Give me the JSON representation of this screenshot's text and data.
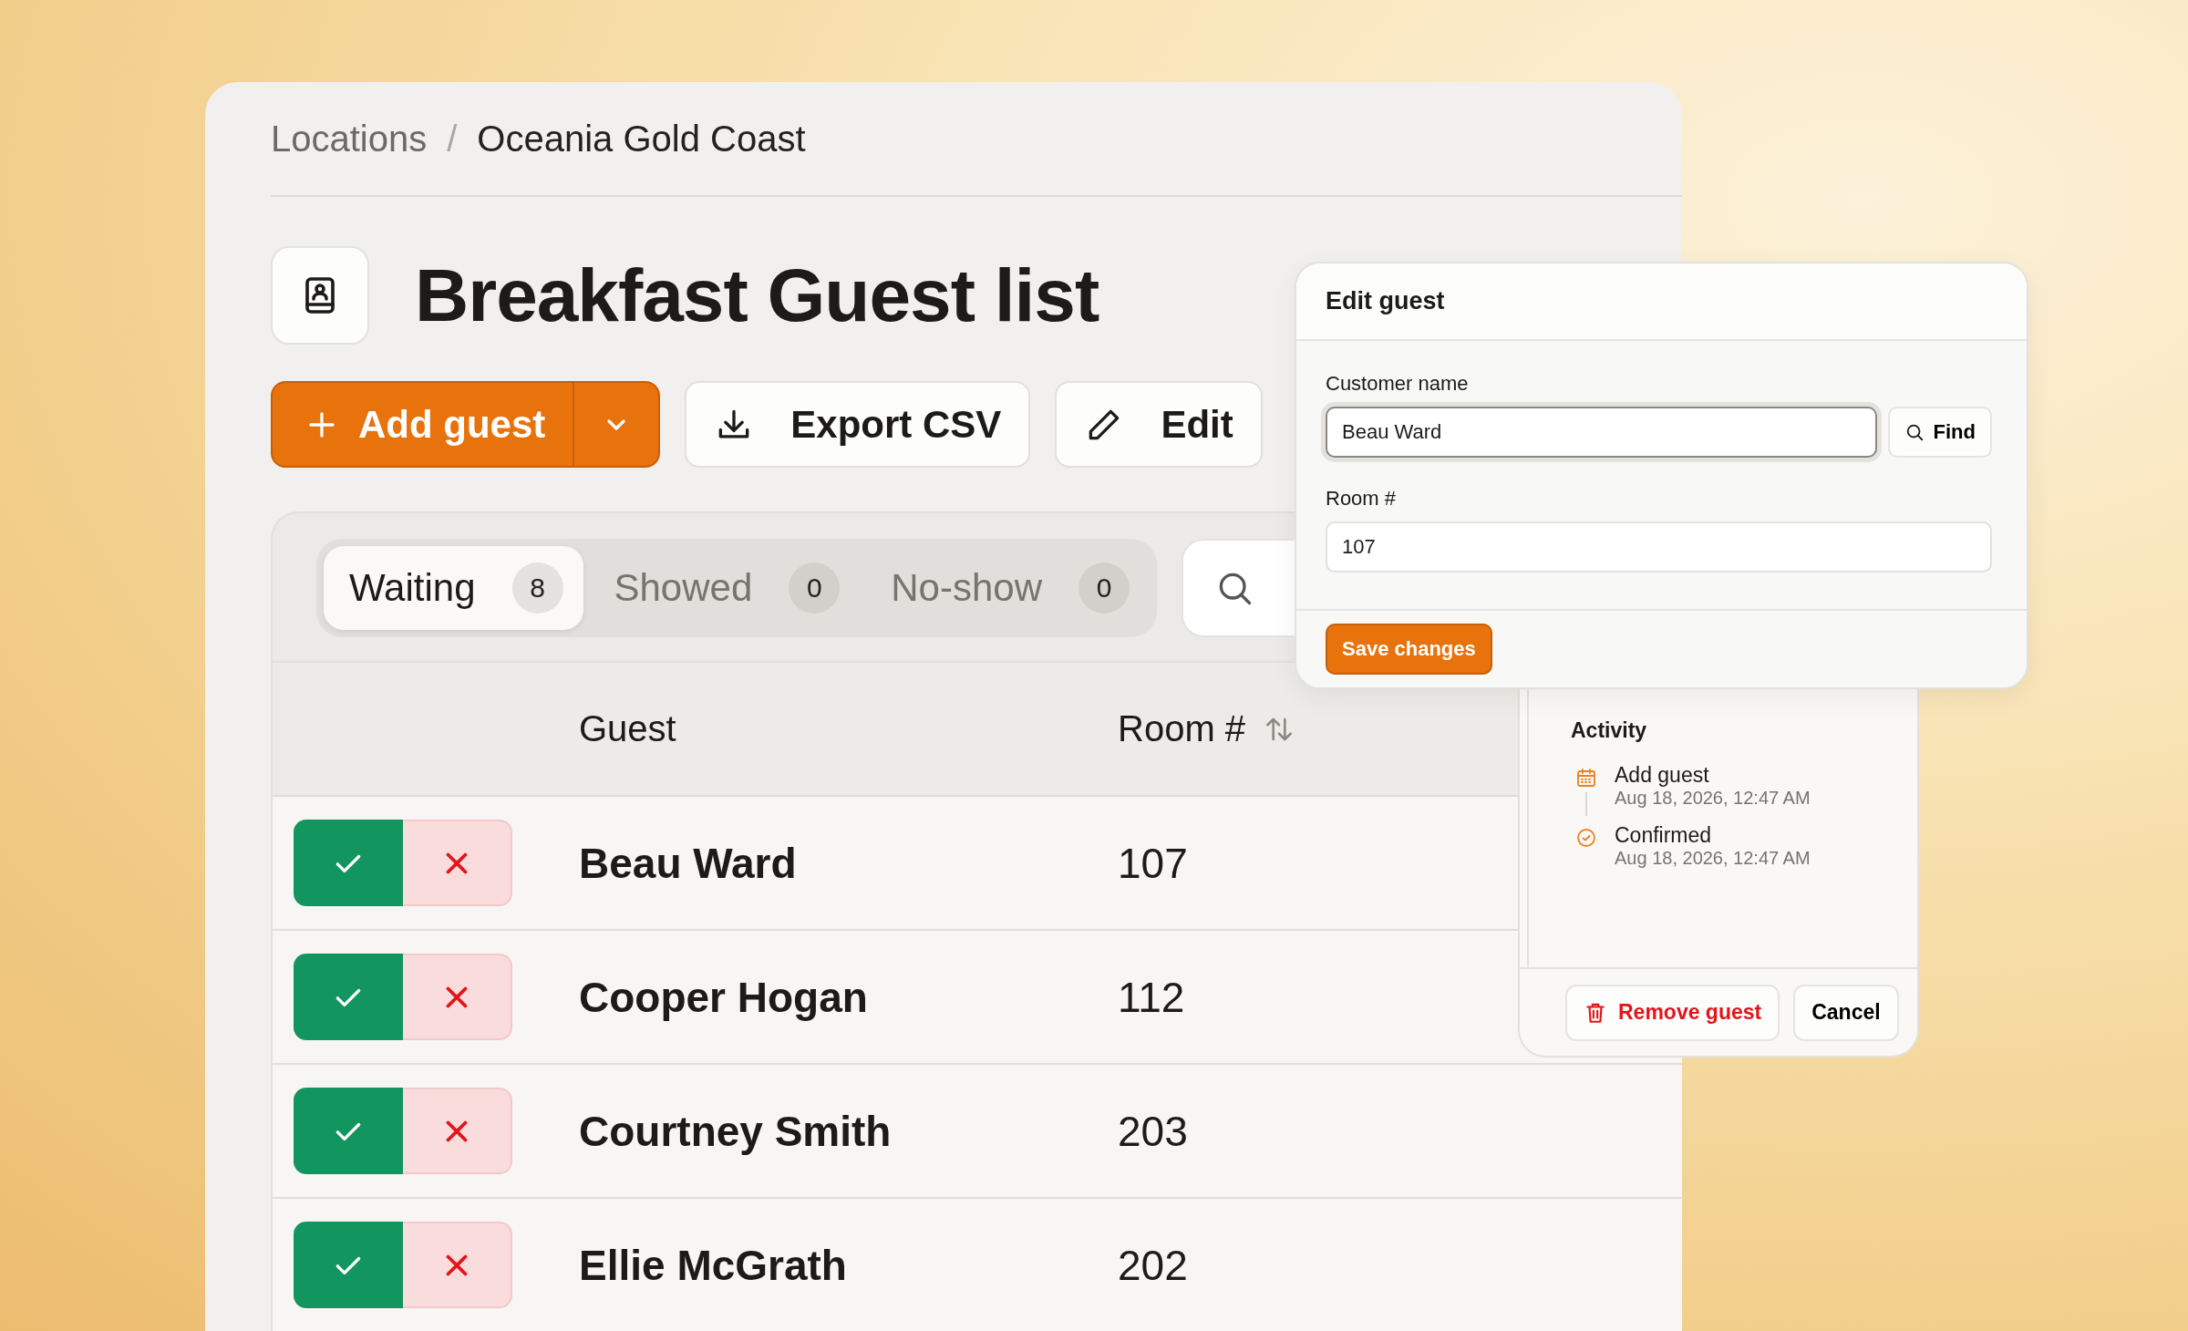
{
  "breadcrumb": [
    {
      "label": "Locations",
      "current": false
    },
    {
      "label": "Oceania Gold Coast",
      "current": true
    }
  ],
  "breadcrumb_separator": "/",
  "title": "Breakfast Guest list",
  "actions": {
    "primary": "Add guest",
    "export": "Export CSV",
    "edit": "Edit"
  },
  "tabs": [
    {
      "label": "Waiting",
      "count": "8",
      "selected": true
    },
    {
      "label": "Showed",
      "count": "0",
      "selected": false
    },
    {
      "label": "No-show",
      "count": "0",
      "selected": false
    }
  ],
  "table": {
    "columns": [
      "Guest",
      "Room #"
    ],
    "rows": [
      {
        "guest": "Beau Ward",
        "room": "107"
      },
      {
        "guest": "Cooper Hogan",
        "room": "112"
      },
      {
        "guest": "Courtney Smith",
        "room": "203"
      },
      {
        "guest": "Ellie McGrath",
        "room": "202"
      }
    ]
  },
  "edit_panel": {
    "title": "Edit guest",
    "fields": [
      {
        "label": "Customer name",
        "value": "Beau Ward",
        "focused": true
      },
      {
        "label": "Room #",
        "value": "107",
        "focused": false
      }
    ],
    "find": "Find",
    "save": "Save changes"
  },
  "activity": {
    "title": "Activity",
    "entries": [
      {
        "kind": "calendar",
        "label": "Add guest",
        "time": "Aug 18, 2026, 12:47 AM"
      },
      {
        "kind": "check",
        "label": "Confirmed",
        "time": "Aug 18, 2026, 12:47 AM"
      }
    ],
    "remove": "Remove guest",
    "cancel": "Cancel"
  }
}
